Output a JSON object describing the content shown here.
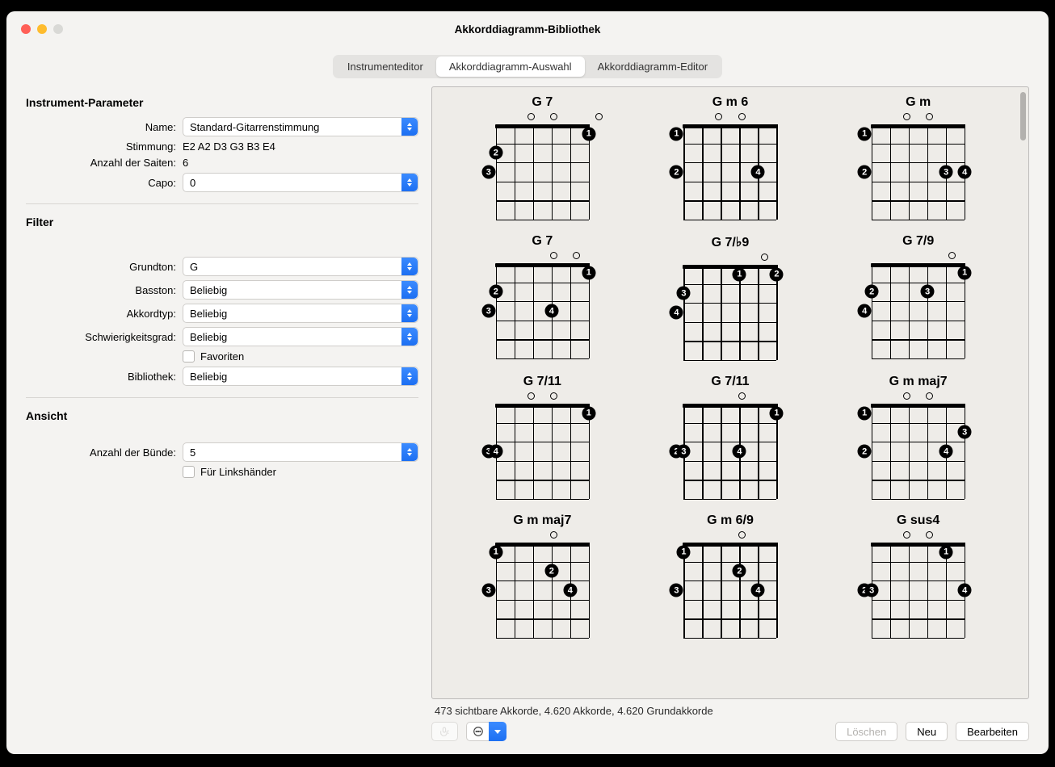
{
  "window": {
    "title": "Akkorddiagramm-Bibliothek"
  },
  "tabs": {
    "editor": "Instrumenteditor",
    "selection": "Akkorddiagramm-Auswahl",
    "chordEditor": "Akkorddiagramm-Editor"
  },
  "sidebar": {
    "paramsTitle": "Instrument-Parameter",
    "nameLabel": "Name:",
    "nameValue": "Standard-Gitarrenstimmung",
    "tuningLabel": "Stimmung:",
    "tuningValue": "E2 A2 D3 G3 B3 E4",
    "stringsLabel": "Anzahl der Saiten:",
    "stringsValue": "6",
    "capoLabel": "Capo:",
    "capoValue": "0",
    "filterTitle": "Filter",
    "rootLabel": "Grundton:",
    "rootValue": "G",
    "bassLabel": "Basston:",
    "bassValue": "Beliebig",
    "chordTypeLabel": "Akkordtyp:",
    "chordTypeValue": "Beliebig",
    "difficultyLabel": "Schwierigkeitsgrad:",
    "difficultyValue": "Beliebig",
    "favoritesLabel": "Favoriten",
    "libraryLabel": "Bibliothek:",
    "libraryValue": "Beliebig",
    "viewTitle": "Ansicht",
    "fretsLabel": "Anzahl der Bünde:",
    "fretsValue": "5",
    "leftyLabel": "Für Linkshänder"
  },
  "footer": {
    "status": "473 sichtbare Akkorde, 4.620 Akkorde, 4.620 Grundakkorde",
    "delete": "Löschen",
    "new": "Neu",
    "edit": "Bearbeiten"
  },
  "chords": [
    {
      "name": "G 7",
      "open": [
        0,
        0,
        1,
        1,
        0,
        1
      ],
      "dots": [
        [
          5,
          1,
          "1"
        ],
        [
          0,
          2,
          "2"
        ],
        [
          -1,
          3,
          "3"
        ]
      ]
    },
    {
      "name": "G m 6",
      "open": [
        0,
        0,
        1,
        1,
        0,
        0
      ],
      "dots": [
        [
          -1,
          1,
          "1"
        ],
        [
          -1,
          3,
          "2"
        ],
        [
          4,
          3,
          "4"
        ]
      ]
    },
    {
      "name": "G m",
      "open": [
        0,
        0,
        1,
        1,
        0,
        0
      ],
      "dots": [
        [
          -1,
          1,
          "1"
        ],
        [
          -1,
          3,
          "2"
        ],
        [
          4,
          3,
          "3"
        ],
        [
          5,
          3,
          "4"
        ]
      ]
    },
    {
      "name": "G 7",
      "open": [
        0,
        0,
        0,
        1,
        1,
        0
      ],
      "dots": [
        [
          5,
          1,
          "1"
        ],
        [
          0,
          2,
          "2"
        ],
        [
          -1,
          3,
          "3"
        ],
        [
          3,
          3,
          "4"
        ]
      ]
    },
    {
      "name": "G 7/♭9",
      "open": [
        0,
        0,
        0,
        0,
        1,
        0
      ],
      "dots": [
        [
          3,
          1,
          "1"
        ],
        [
          5,
          1,
          "2"
        ],
        [
          0,
          2,
          "3"
        ],
        [
          -1,
          3,
          "4"
        ]
      ]
    },
    {
      "name": "G 7/9",
      "open": [
        0,
        0,
        0,
        0,
        1,
        0
      ],
      "dots": [
        [
          5,
          1,
          "1"
        ],
        [
          0,
          2,
          "2"
        ],
        [
          3,
          2,
          "3"
        ],
        [
          -1,
          3,
          "4"
        ]
      ]
    },
    {
      "name": "G 7/11",
      "open": [
        0,
        0,
        1,
        1,
        0,
        0
      ],
      "dots": [
        [
          5,
          1,
          "1"
        ],
        [
          -1,
          3,
          "3"
        ],
        [
          0,
          3,
          "4"
        ]
      ]
    },
    {
      "name": "G 7/11",
      "open": [
        0,
        0,
        0,
        1,
        0,
        0
      ],
      "dots": [
        [
          5,
          1,
          "1"
        ],
        [
          -1,
          3,
          "2"
        ],
        [
          0,
          3,
          "3"
        ],
        [
          3,
          3,
          "4"
        ]
      ]
    },
    {
      "name": "G m maj7",
      "open": [
        0,
        0,
        1,
        1,
        0,
        0
      ],
      "dots": [
        [
          -1,
          1,
          "1"
        ],
        [
          5,
          2,
          "3"
        ],
        [
          -1,
          3,
          "2"
        ],
        [
          4,
          3,
          "4"
        ]
      ]
    },
    {
      "name": "G m maj7",
      "open": [
        0,
        0,
        0,
        1,
        0,
        0
      ],
      "dots": [
        [
          0,
          1,
          "1"
        ],
        [
          3,
          2,
          "2"
        ],
        [
          -1,
          3,
          "3"
        ],
        [
          4,
          3,
          "4"
        ]
      ]
    },
    {
      "name": "G m 6/9",
      "open": [
        0,
        0,
        0,
        1,
        0,
        0
      ],
      "dots": [
        [
          0,
          1,
          "1"
        ],
        [
          3,
          2,
          "2"
        ],
        [
          -1,
          3,
          "3"
        ],
        [
          4,
          3,
          "4"
        ]
      ]
    },
    {
      "name": "G sus4",
      "open": [
        0,
        0,
        1,
        1,
        0,
        0
      ],
      "dots": [
        [
          4,
          1,
          "1"
        ],
        [
          -1,
          3,
          "2"
        ],
        [
          0,
          3,
          "3"
        ],
        [
          5,
          3,
          "4"
        ]
      ]
    }
  ]
}
